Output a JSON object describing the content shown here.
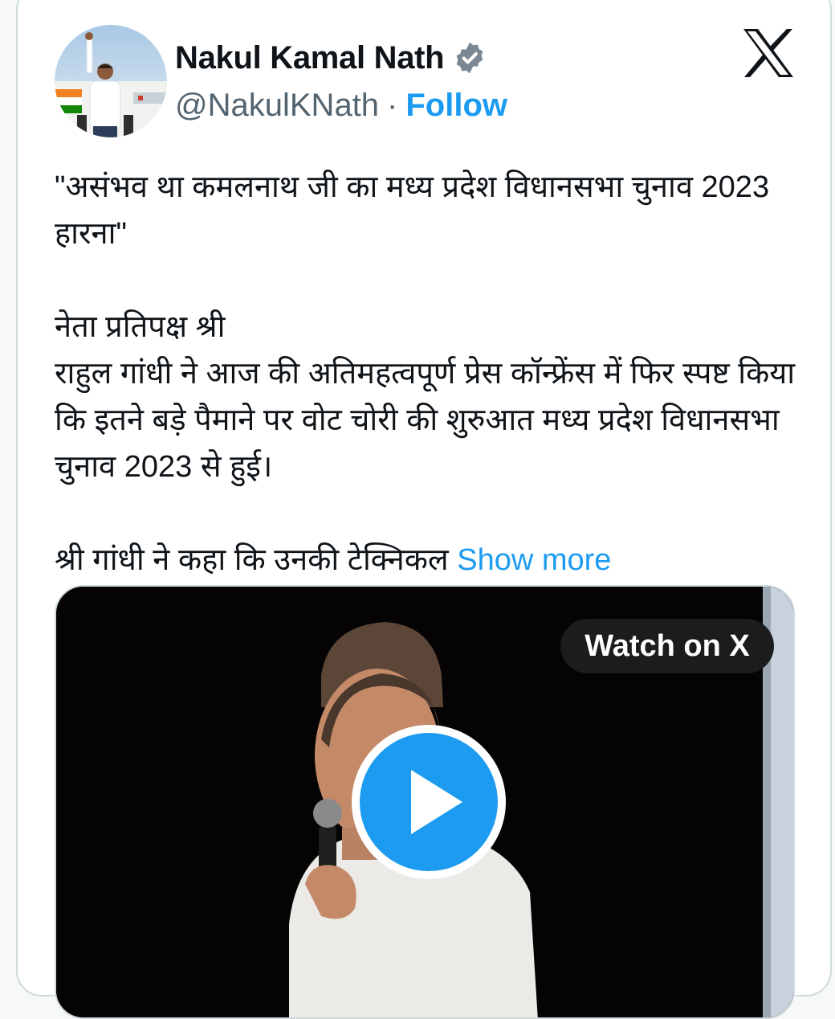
{
  "author": {
    "name": "Nakul Kamal Nath",
    "handle": "@NakulKNath",
    "separator": "·",
    "follow_label": "Follow",
    "verified": true
  },
  "tweet": {
    "text": "\"असंभव था कमलनाथ जी का मध्य प्रदेश विधानसभा चुनाव 2023 हारना\"\n\nनेता प्रतिपक्ष श्री\nराहुल गांधी ने आज की अतिमहत्वपूर्ण प्रेस कॉन्फ्रेंस में फिर स्पष्ट किया कि इतने बड़े पैमाने पर वोट चोरी की शुरुआत मध्य प्रदेश विधानसभा चुनाव 2023 से हुई।\n\nश्री गांधी ने कहा कि उनकी टेक्निकल ",
    "show_more_label": "Show more"
  },
  "media": {
    "watch_label": "Watch on X",
    "play_icon": "play-icon"
  },
  "icons": {
    "logo": "x-logo-icon",
    "badge": "verified-badge-icon"
  },
  "colors": {
    "link": "#1d9bf0",
    "text": "#0f1419",
    "secondary": "#536471",
    "border": "#cfd9de",
    "play": "#1d9bf0"
  }
}
